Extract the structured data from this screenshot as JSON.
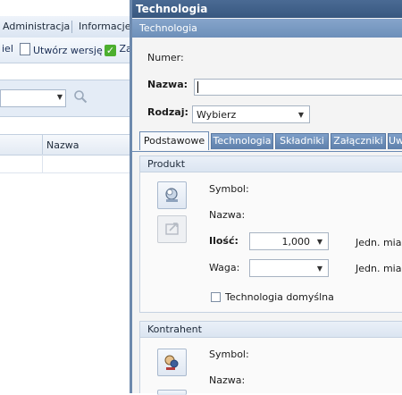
{
  "background_app": {
    "menu": [
      "Administracja",
      "Informacje"
    ],
    "toolbar": [
      "iel",
      "Utwórz wersję",
      "Za"
    ],
    "grid": {
      "columns": [
        "Nazwa"
      ]
    }
  },
  "dialog": {
    "title": "Technologia",
    "header": "Technologia",
    "fields": {
      "numer_label": "Numer:",
      "nazwa_label": "Nazwa:",
      "nazwa_value": "",
      "rodzaj_label": "Rodzaj:",
      "rodzaj_value": "Wybierz"
    },
    "tabs": [
      "Podstawowe",
      "Technologia",
      "Składniki",
      "Załączniki",
      "Uw"
    ],
    "active_tab": "Podstawowe",
    "produkt": {
      "title": "Produkt",
      "symbol_label": "Symbol:",
      "nazwa_label": "Nazwa:",
      "ilosc_label": "Ilość:",
      "ilosc_value": "1,000",
      "jedn_label_1": "Jedn. miary",
      "waga_label": "Waga:",
      "waga_value": "",
      "jedn_label_2": "Jedn. miary",
      "default_checkbox_label": "Technologia domyślna"
    },
    "kontrahent": {
      "title": "Kontrahent",
      "symbol_label": "Symbol:",
      "nazwa_label": "Nazwa:"
    }
  },
  "colors": {
    "title_bar": "#38587f",
    "header_bar": "#6d8fb9",
    "tab_inactive": "#5e80ab",
    "accept_green": "#4caf2f"
  }
}
